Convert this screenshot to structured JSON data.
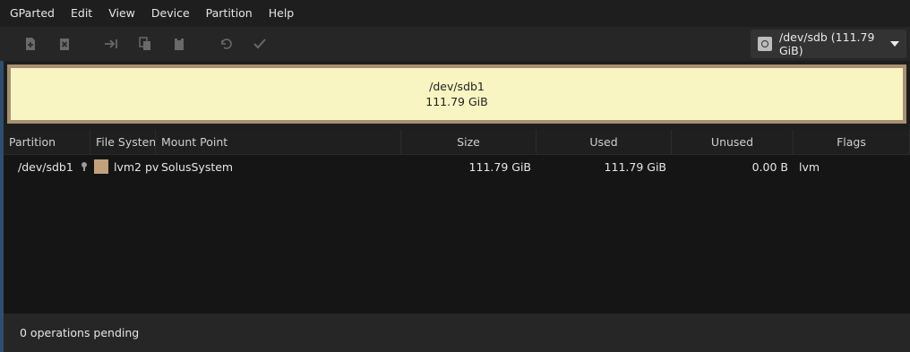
{
  "menubar": {
    "items": [
      "GParted",
      "Edit",
      "View",
      "Device",
      "Partition",
      "Help"
    ]
  },
  "toolbar": {
    "buttons": [
      "new-icon",
      "delete-icon",
      "resize-move-icon",
      "copy-icon",
      "paste-icon",
      "undo-icon",
      "apply-icon"
    ],
    "device": "/dev/sdb (111.79 GiB)"
  },
  "visual": {
    "name": "/dev/sdb1",
    "size": "111.79 GiB",
    "fill_color": "#f8f5c2",
    "border_color": "#a89070"
  },
  "table": {
    "columns": [
      "Partition",
      "File System",
      "Mount Point",
      "Size",
      "Used",
      "Unused",
      "Flags"
    ],
    "rows": [
      {
        "partition": "/dev/sdb1",
        "filesystem": "lvm2 pv",
        "fs_color": "#c2a27a",
        "mount": "SolusSystem",
        "size": "111.79 GiB",
        "used": "111.79 GiB",
        "unused": "0.00 B",
        "flags": "lvm"
      }
    ]
  },
  "status": {
    "text": "0 operations pending"
  }
}
